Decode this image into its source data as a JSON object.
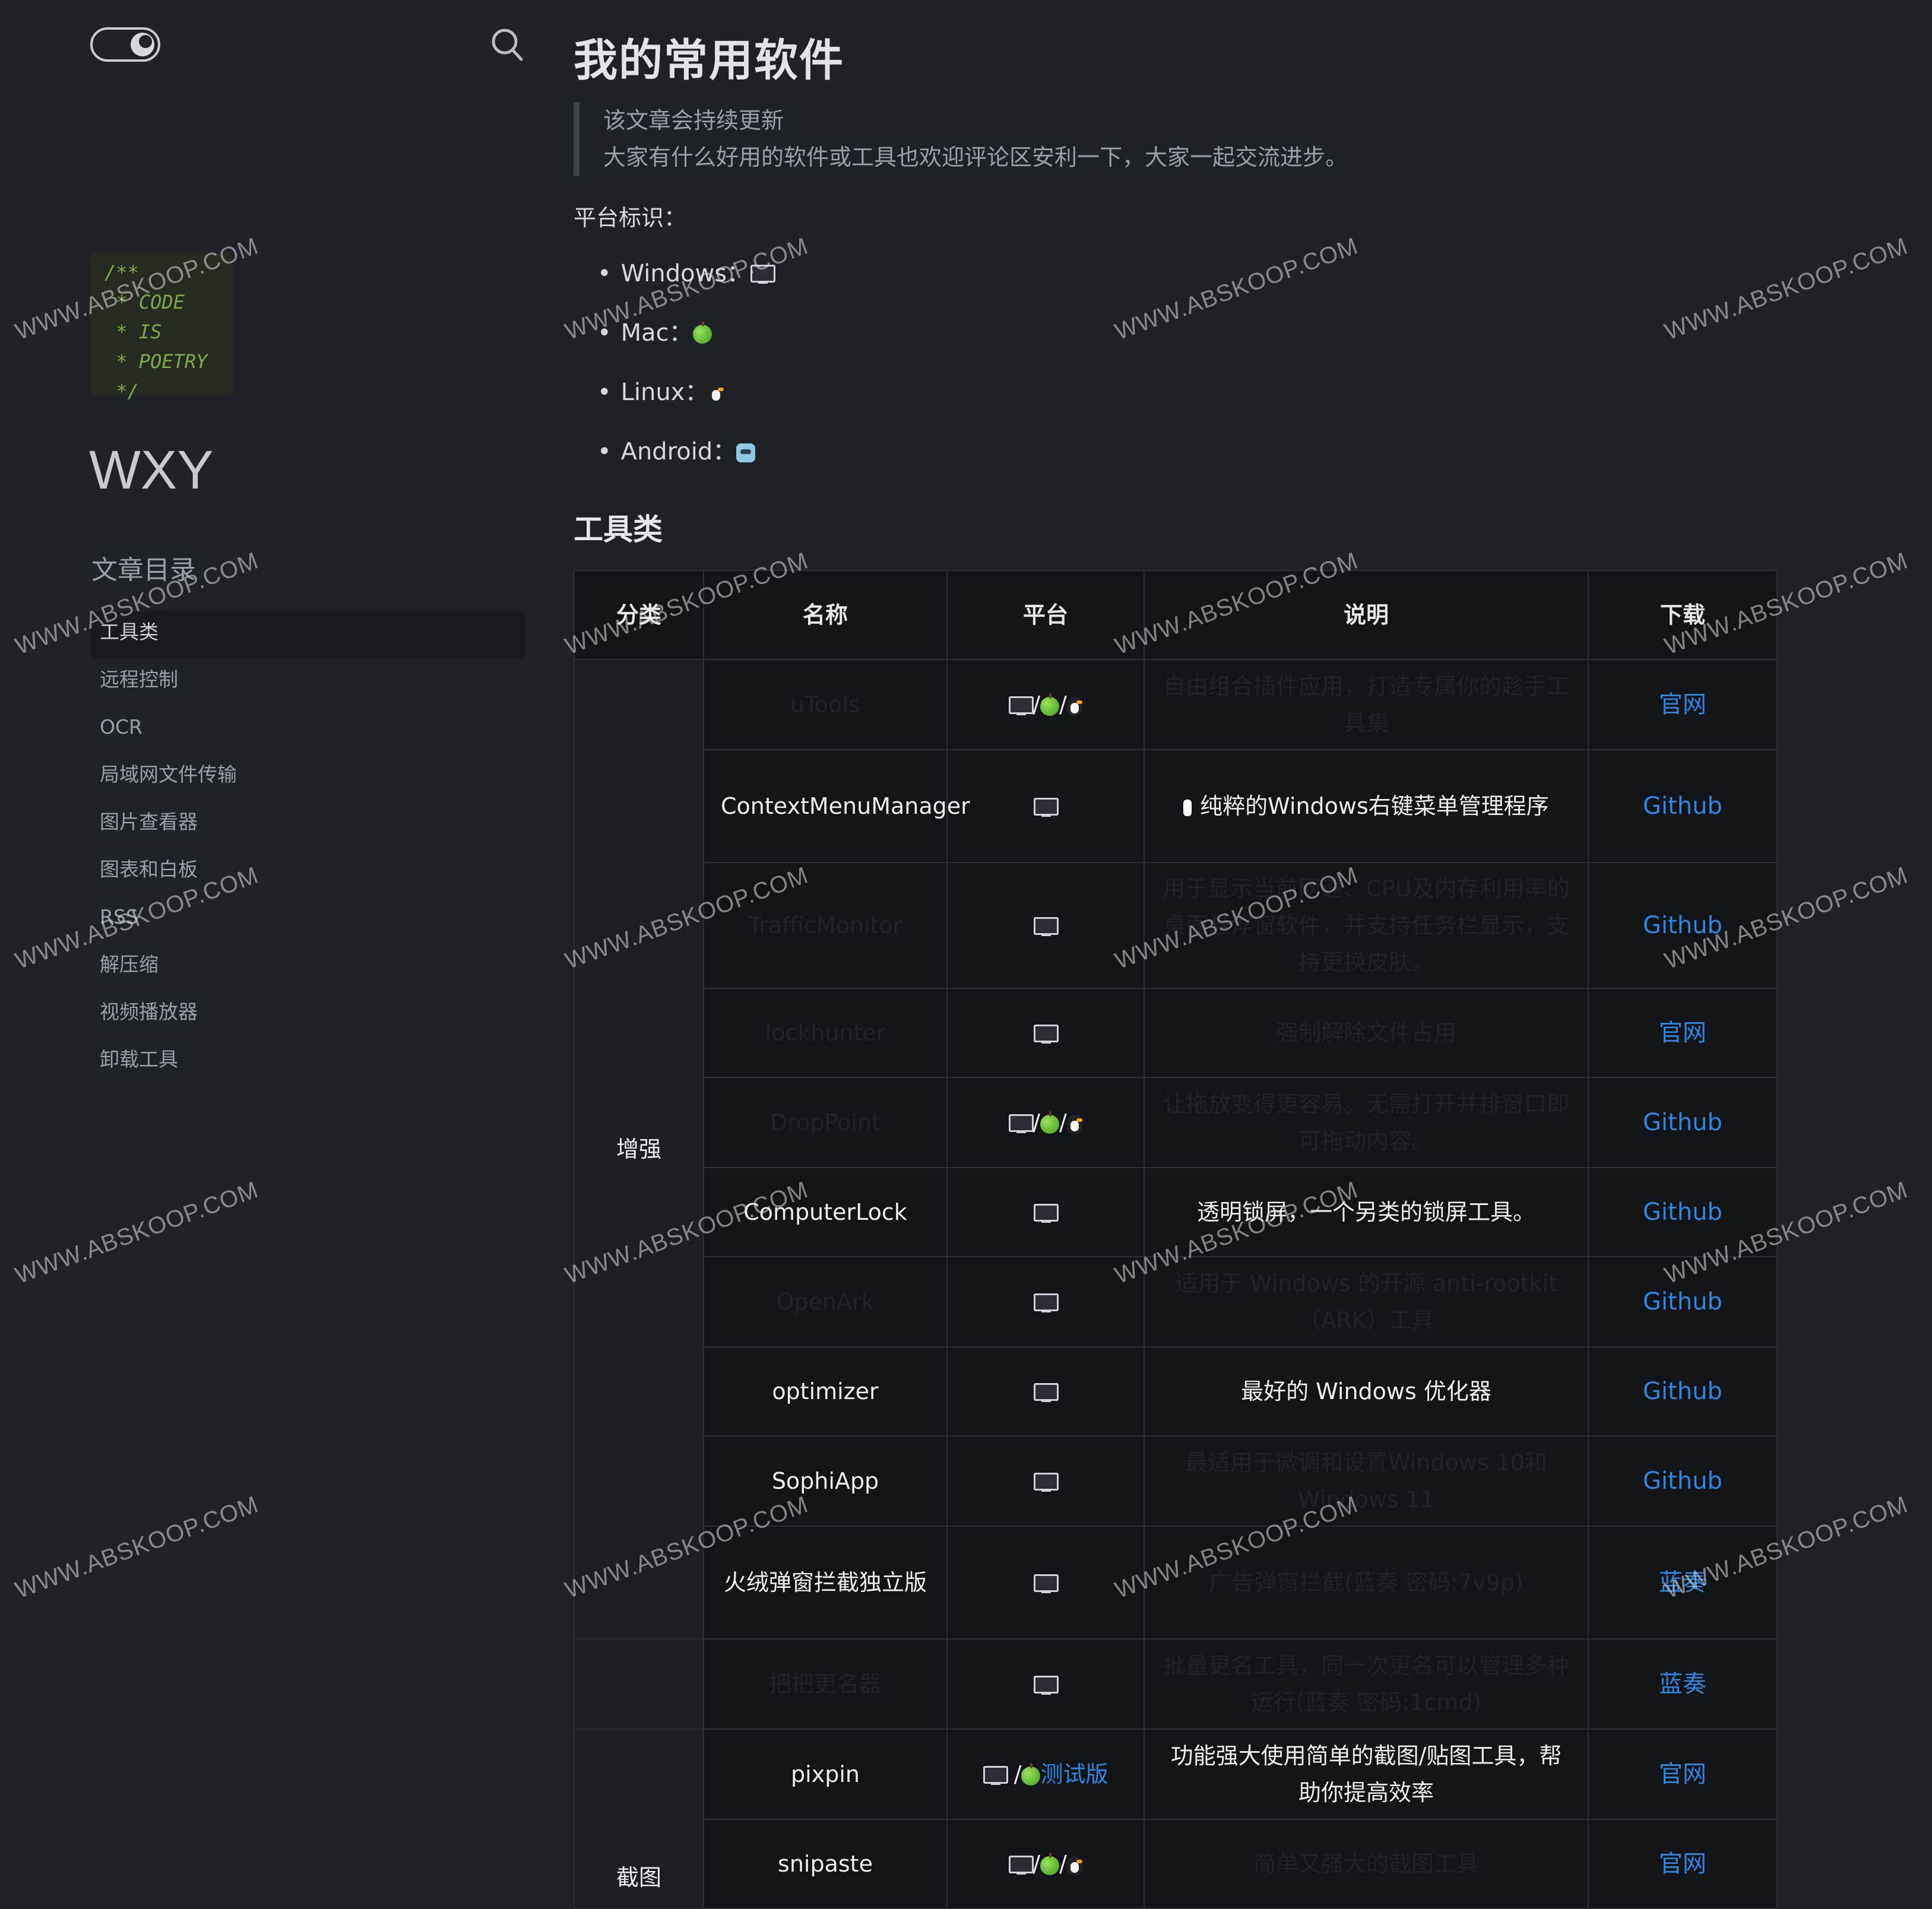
{
  "sidebar": {
    "code_card": [
      "/**",
      " * CODE",
      " * IS",
      " * POETRY",
      " */"
    ],
    "site_title": "WXY",
    "toc_title": "文章目录",
    "toc_items": [
      "工具类",
      "远程控制",
      "OCR",
      "局域网文件传输",
      "图片查看器",
      "图表和白板",
      "RSS",
      "解压缩",
      "视频播放器",
      "卸载工具"
    ]
  },
  "article": {
    "title": "我的常用软件",
    "quote": [
      "该文章会持续更新",
      "大家有什么好用的软件或工具也欢迎评论区安利一下，大家一起交流进步。"
    ],
    "platform_label": "平台标识：",
    "platforms": [
      {
        "name": "Windows：",
        "icon": "monitor-icon"
      },
      {
        "name": "Mac：",
        "icon": "green-apple-icon"
      },
      {
        "name": "Linux：",
        "icon": "penguin-icon"
      },
      {
        "name": "Android：",
        "icon": "robot-icon"
      }
    ],
    "section_title": "工具类"
  },
  "table": {
    "headers": [
      "分类",
      "名称",
      "平台",
      "说明",
      "下载"
    ],
    "rows": [
      {
        "category": "增强",
        "name": "uTools",
        "platform": "win-mac-linux",
        "desc": "自由组合插件应用，打造专属你的趁手工具集",
        "download": "官网"
      },
      {
        "category": "",
        "name": "ContextMenuManager",
        "platform": "win",
        "desc": "纯粹的Windows右键菜单管理程序",
        "download": "Github"
      },
      {
        "category": "",
        "name": "TrafficMonitor",
        "platform": "win",
        "desc": "用于显示当前网速、CPU及内存利用率的桌面悬浮窗软件，并支持任务栏显示，支持更换皮肤。",
        "download": "Github"
      },
      {
        "category": "",
        "name": "lockhunter",
        "platform": "win",
        "desc": "强制解除文件占用",
        "download": "官网"
      },
      {
        "category": "",
        "name": "DropPoint",
        "platform": "win-mac-linux",
        "desc": "让拖放变得更容易。无需打开并排窗口即可拖动内容。",
        "download": "Github"
      },
      {
        "category": "",
        "name": "ComputerLock",
        "platform": "win",
        "desc": "透明锁屏，一个另类的锁屏工具。",
        "download": "Github"
      },
      {
        "category": "",
        "name": "OpenArk",
        "platform": "win",
        "desc": "适用于 Windows 的开源 anti-rootkit（ARK）工具",
        "download": "Github"
      },
      {
        "category": "",
        "name": "optimizer",
        "platform": "win",
        "desc": "最好的 Windows 优化器",
        "download": "Github"
      },
      {
        "category": "",
        "name": "SophiApp",
        "platform": "win",
        "desc": "最适用于微调和设置Windows 10和Windows 11",
        "download": "Github"
      },
      {
        "category": "",
        "name": "火绒弹窗拦截独立版",
        "platform": "win",
        "desc": "广告弹窗拦截(蓝奏 密码:7v9p)",
        "download": "蓝奏"
      },
      {
        "category": "",
        "name": "把把更名器",
        "platform": "win",
        "desc": "批量更名工具，同一次更名可以管理多种运行(蓝奏 密码:1cmd)",
        "download": "蓝奏"
      },
      {
        "category": "截图",
        "name": "pixpin",
        "platform": "win-mac-beta",
        "desc": "功能强大使用简单的截图/贴图工具，帮助你提高效率",
        "download": "官网"
      },
      {
        "category": "",
        "name": "snipaste",
        "platform": "win-mac-linux",
        "desc": "简单又强大的截图工具",
        "download": "官网"
      }
    ],
    "beta_label": "测试版"
  },
  "watermark": "WWW.ABSKOOP.COM",
  "colors": {
    "background": "#1e2126",
    "table_bg": "#121418",
    "link": "#2f86e0",
    "code": "#7ea94a"
  }
}
